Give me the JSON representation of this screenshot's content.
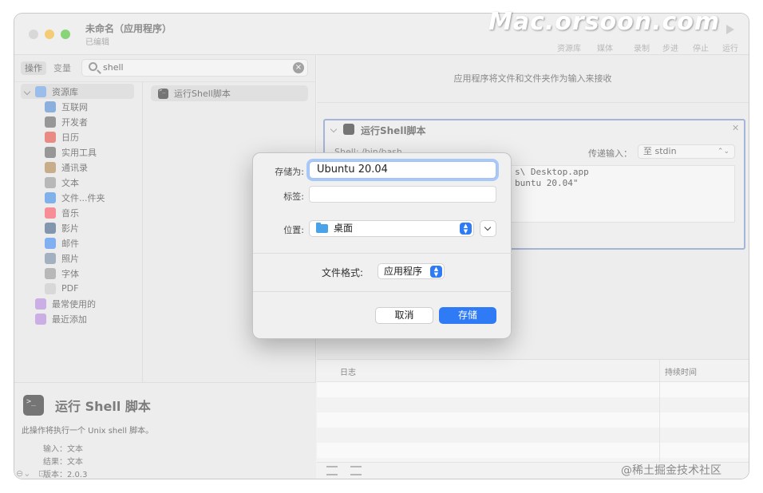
{
  "window": {
    "title": "未命名（应用程序）",
    "subtitle": "已编辑",
    "toolbar": [
      "资源库",
      "媒体",
      "录制",
      "步进",
      "停止",
      "运行"
    ]
  },
  "watermark": {
    "brand": "Mac.orsoon.com",
    "credit": "@稀土掘金技术社区"
  },
  "left": {
    "tabs": [
      "操作",
      "变量"
    ],
    "search_value": "shell",
    "library": [
      {
        "label": "资源库",
        "icon": "library-icon",
        "color": "#6fa2e0"
      },
      {
        "label": "互联网",
        "icon": "globe-icon",
        "color": "#5a8fd0"
      },
      {
        "label": "开发者",
        "icon": "tools-icon",
        "color": "#6b6b6b"
      },
      {
        "label": "日历",
        "icon": "calendar-icon",
        "color": "#e05a4f"
      },
      {
        "label": "实用工具",
        "icon": "utilities-icon",
        "color": "#6b6b6b"
      },
      {
        "label": "通讯录",
        "icon": "contacts-icon",
        "color": "#b08a5a"
      },
      {
        "label": "文本",
        "icon": "text-icon",
        "color": "#9a9a9a"
      },
      {
        "label": "文件...件夹",
        "icon": "finder-icon",
        "color": "#4a90e2"
      },
      {
        "label": "音乐",
        "icon": "music-icon",
        "color": "#f25c6b"
      },
      {
        "label": "影片",
        "icon": "movie-icon",
        "color": "#4d6a8a"
      },
      {
        "label": "邮件",
        "icon": "mail-icon",
        "color": "#4a8fe8"
      },
      {
        "label": "照片",
        "icon": "photos-icon",
        "color": "#7a8ea4"
      },
      {
        "label": "字体",
        "icon": "fonts-icon",
        "color": "#9a9a9a"
      },
      {
        "label": "PDF",
        "icon": "pdf-icon",
        "color": "#c8c8c8"
      },
      {
        "label": "最常使用的",
        "icon": "smart-folder-icon",
        "color": "#b38cd8"
      },
      {
        "label": "最近添加",
        "icon": "smart-folder-icon",
        "color": "#b38cd8"
      }
    ],
    "action_result": "运行Shell脚本",
    "description": {
      "title": "运行 Shell 脚本",
      "text": "此操作将执行一个 Unix shell 脚本。",
      "input": "输入：文本",
      "result": "结果：文本",
      "version": "版本：2.0.3"
    }
  },
  "right": {
    "hint": "应用程序将文件和文件夹作为输入来接收",
    "card": {
      "title": "运行Shell脚本",
      "shell_label": "Shell:  /bin/bash",
      "pass_label": "传递输入：",
      "pass_value": "至 stdin",
      "code": [
        "s\\ Desktop.app",
        "buntu 20.04\""
      ]
    },
    "log": {
      "col_log": "日志",
      "col_duration": "持续时间"
    }
  },
  "dialog": {
    "save_as_label": "存储为:",
    "save_as_value": "Ubuntu 20.04",
    "tags_label": "标签:",
    "where_label": "位置:",
    "where_value": "桌面",
    "format_label": "文件格式:",
    "format_value": "应用程序",
    "cancel_label": "取消",
    "save_label": "存储",
    "accent": "#2f7bf5"
  }
}
